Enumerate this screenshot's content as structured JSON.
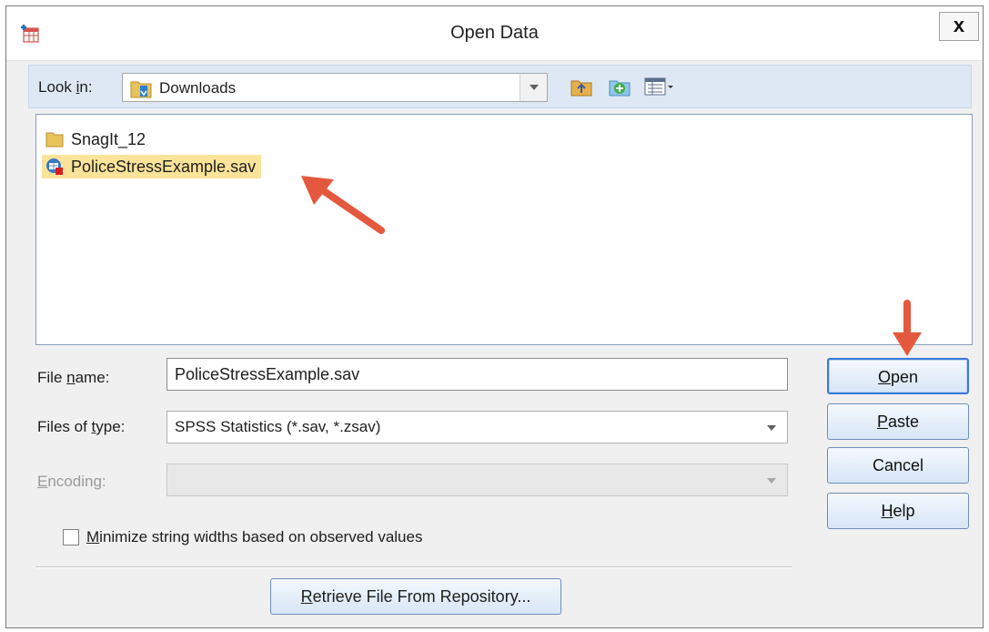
{
  "window": {
    "title": "Open Data",
    "close_label": "x"
  },
  "lookin": {
    "label": "Look in:",
    "value": "Downloads"
  },
  "toolbar": {
    "icons": [
      "up-folder-icon",
      "new-folder-icon",
      "view-menu-icon"
    ]
  },
  "files": [
    {
      "name": "SnagIt_12",
      "type": "folder",
      "selected": false
    },
    {
      "name": "PoliceStressExample.sav",
      "type": "spss-data",
      "selected": true
    }
  ],
  "form": {
    "filename_label": "File name:",
    "filename_value": "PoliceStressExample.sav",
    "filetype_label": "Files of type:",
    "filetype_value": "SPSS Statistics (*.sav, *.zsav)",
    "encoding_label": "Encoding:",
    "encoding_value": "",
    "minimize_label": "Minimize string widths based on observed values",
    "minimize_checked": false
  },
  "buttons": {
    "open": "Open",
    "paste": "Paste",
    "cancel": "Cancel",
    "help": "Help",
    "retrieve": "Retrieve File From Repository..."
  },
  "colors": {
    "selection": "#fbe39a",
    "annotation_arrow": "#e4583d",
    "toolbar_bg": "#dde8f4"
  }
}
